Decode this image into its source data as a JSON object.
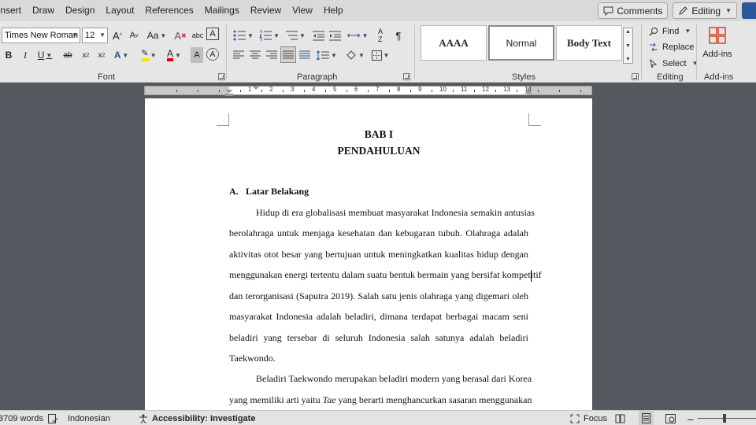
{
  "menu": {
    "tabs": [
      "Insert",
      "Draw",
      "Design",
      "Layout",
      "References",
      "Mailings",
      "Review",
      "View",
      "Help"
    ],
    "comments_label": "Comments",
    "editing_label": "Editing"
  },
  "ribbon": {
    "font_name": "Times New Roman",
    "font_size": "12",
    "style_gallery": [
      "AAAA",
      "Normal",
      "Body Text"
    ],
    "find_label": "Find",
    "replace_label": "Replace",
    "select_label": "Select",
    "addins_label": "Add-ins",
    "groups": {
      "font": "Font",
      "paragraph": "Paragraph",
      "styles": "Styles",
      "editing": "Editing",
      "addins": "Add-ins"
    },
    "accent_colors": {
      "highlight": "#f7e300",
      "font_color": "#e00000"
    }
  },
  "ruler": {
    "labels": [
      "1",
      "2",
      "3",
      "4",
      "5",
      "6",
      "7",
      "8",
      "9",
      "10",
      "11",
      "12",
      "13",
      "14"
    ]
  },
  "document": {
    "title_line1": "BAB I",
    "title_line2": "PENDAHULUAN",
    "section_number": "A.",
    "section_title": "Latar Belakang",
    "lines": [
      "Hidup di era globalisasi membuat masyarakat Indonesia semakin antusias",
      "berolahraga untuk menjaga kesehatan dan kebugaran tubuh. Olahraga adalah",
      "aktivitas otot besar yang bertujuan untuk meningkatkan kualitas hidup dengan",
      "menggunakan energi tertentu dalam suatu bentuk bermain yang bersifat kompetitif",
      "dan terorganisasi (Saputra 2019). Salah satu jenis olahraga yang digemari oleh",
      "masyarakat Indonesia adalah beladiri, dimana terdapat berbagai macam seni",
      "beladiri yang tersebar di  seluruh Indonesia salah satunya adalah beladiri",
      "Taekwondo.",
      "Beladiri Taekwondo merupakan beladiri modern yang berasal dari Korea"
    ],
    "last_line_before": "yang memiliki arti yaitu ",
    "last_line_italic": "Tae",
    "last_line_after": " yang berarti menghancurkan sasaran menggunakan"
  },
  "status": {
    "word_count": "3709 words",
    "language": "Indonesian",
    "accessibility": "Accessibility: Investigate",
    "focus_label": "Focus"
  }
}
